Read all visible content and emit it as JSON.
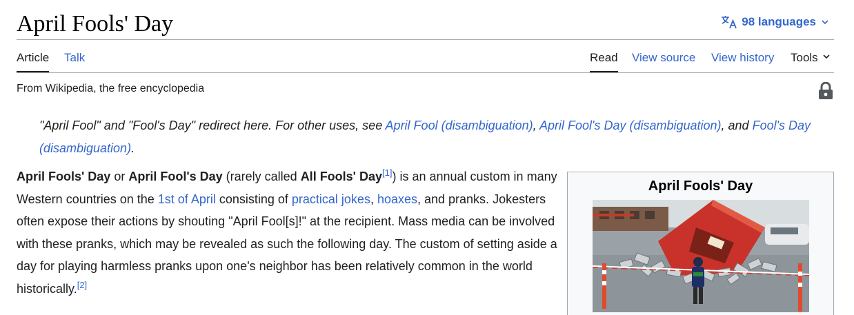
{
  "header": {
    "title": "April Fools' Day",
    "languages_label": "98 languages"
  },
  "tabs": {
    "left": [
      {
        "label": "Article",
        "active": true
      },
      {
        "label": "Talk",
        "active": false
      }
    ],
    "right": [
      {
        "label": "Read",
        "active": true
      },
      {
        "label": "View source",
        "active": false
      },
      {
        "label": "View history",
        "active": false
      },
      {
        "label": "Tools",
        "active": false
      }
    ]
  },
  "tagline": "From Wikipedia, the free encyclopedia",
  "hatnote": {
    "prefix": "\"April Fool\" and \"Fool's Day\" redirect here. For other uses, see ",
    "link1": "April Fool (disambiguation)",
    "sep1": ", ",
    "link2": "April Fool's Day (disambiguation)",
    "sep2": ", and ",
    "link3": "Fool's Day (disambiguation)",
    "suffix": "."
  },
  "lead": {
    "b1": "April Fools' Day",
    "t1": " or ",
    "b2": "April Fool's Day",
    "t2": " (rarely called ",
    "b3": "All Fools' Day",
    "ref1": "[1]",
    "t3": ") is an annual custom in many Western countries on the ",
    "link1": "1st of April",
    "t4": " consisting of ",
    "link2": "practical jokes",
    "t5": ", ",
    "link3": "hoaxes",
    "t6": ", and pranks. Jokesters often expose their actions by shouting \"April Fool[s]!\" at the recipient. Mass media can be involved with these pranks, which may be revealed as such the following day. The custom of setting aside a day for playing harmless pranks upon one's neighbor has been relatively common in the world historically.",
    "ref2": "[2]"
  },
  "infobox": {
    "title": "April Fools' Day"
  },
  "icons": {
    "language": "translate-icon",
    "chevron": "chevron-down-icon",
    "lock": "lock-icon"
  },
  "colors": {
    "link": "#3366cc",
    "text": "#202122",
    "border": "#a2a9b1",
    "infobox_bg": "#f8f9fa"
  }
}
